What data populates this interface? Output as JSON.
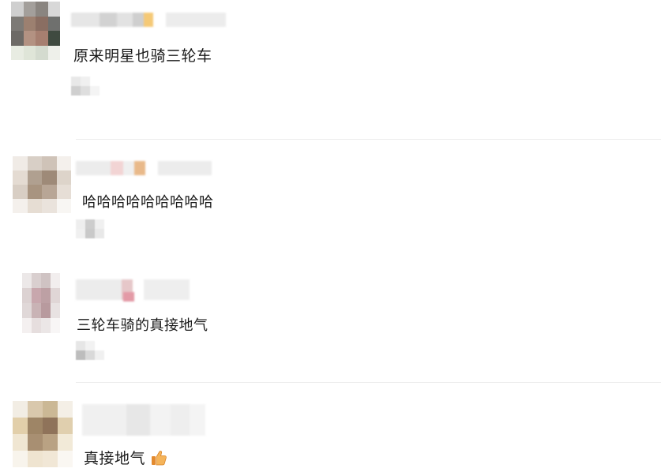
{
  "comments": [
    {
      "text": "原来明星也骑三轮车"
    },
    {
      "text": "哈哈哈哈哈哈哈哈哈"
    },
    {
      "text": "三轮车骑的真接地气"
    },
    {
      "text": "真接地气"
    }
  ],
  "reaction": {
    "icon": "thumbs-up-icon"
  },
  "colors": {
    "text": "#1a1a1a",
    "divider": "#ececec",
    "thumb": "#f0a040"
  }
}
